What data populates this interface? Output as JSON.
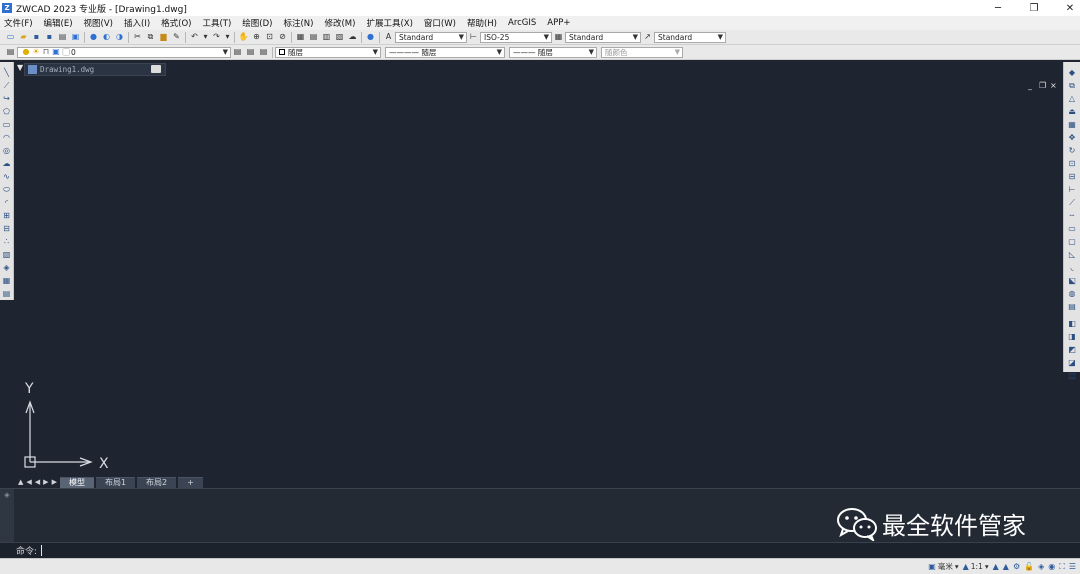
{
  "window": {
    "title": "ZWCAD 2023 专业版 - [Drawing1.dwg]",
    "controls": {
      "minimize": "─",
      "maximize": "❐",
      "close": "✕"
    }
  },
  "menu": [
    "文件(F)",
    "编辑(E)",
    "视图(V)",
    "插入(I)",
    "格式(O)",
    "工具(T)",
    "绘图(D)",
    "标注(N)",
    "修改(M)",
    "扩展工具(X)",
    "窗口(W)",
    "帮助(H)",
    "ArcGIS",
    "APP+"
  ],
  "toolbar1": {
    "text_style": "Standard",
    "dim_style": "ISO-25",
    "table_style": "Standard",
    "mleader_style": "Standard"
  },
  "toolbar2": {
    "layer": "0",
    "color": "随层",
    "linetype": "———— 随层",
    "lineweight": "——— 随层",
    "plotstyle": "随颜色"
  },
  "document_tab": {
    "label": "Drawing1.dwg",
    "icon": "dwg-file-icon"
  },
  "viewport_controls": {
    "minimize": "_",
    "restore": "❐",
    "close": "×"
  },
  "ucs": {
    "y_label": "Y",
    "x_label": "X"
  },
  "layout_tabs": {
    "nav": [
      "▲",
      "◀",
      "◀",
      "▶",
      "▶"
    ],
    "tabs": [
      {
        "label": "模型",
        "active": true
      },
      {
        "label": "布局1",
        "active": false
      },
      {
        "label": "布局2",
        "active": false
      }
    ],
    "add": "+"
  },
  "command": {
    "label": "命令:",
    "grip": "◈"
  },
  "statusbar": {
    "units": "毫米",
    "scale": "1:1"
  },
  "watermark": {
    "text": "最全软件管家",
    "icon": "wechat-icon"
  },
  "colors": {
    "canvas": "#1e2531",
    "accent": "#2f6fd1",
    "toolbar": "#e9e9e9"
  }
}
